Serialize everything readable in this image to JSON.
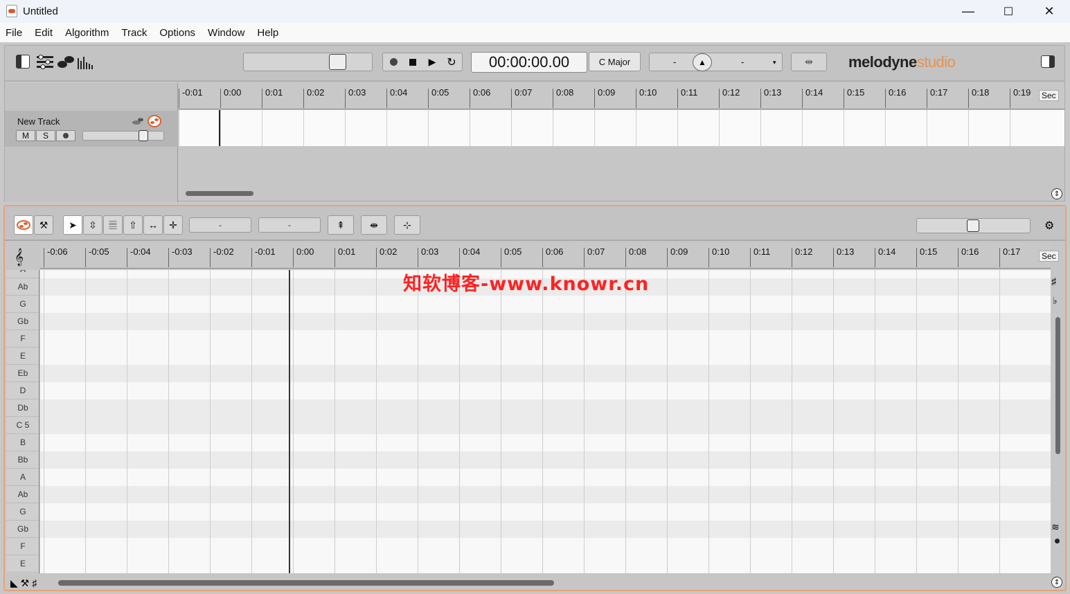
{
  "window": {
    "title": "Untitled",
    "minimize": "—",
    "maximize": "☐",
    "close": "✕"
  },
  "menu": [
    "File",
    "Edit",
    "Algorithm",
    "Track",
    "Options",
    "Window",
    "Help"
  ],
  "transport": {
    "time": "00:00:00.00",
    "key": "C Major",
    "tempo_left": "-",
    "tempo_right": "-"
  },
  "logo": {
    "main": "melodyne",
    "edition": "studio"
  },
  "arrangement": {
    "ruler_labels": [
      "-0:01",
      "0:00",
      "0:01",
      "0:02",
      "0:03",
      "0:04",
      "0:05",
      "0:06",
      "0:07",
      "0:08",
      "0:09",
      "0:10",
      "0:11",
      "0:12",
      "0:13",
      "0:14",
      "0:15",
      "0:16",
      "0:17",
      "0:18",
      "0:19"
    ],
    "ruler_unit": "Sec",
    "track": {
      "name": "New Track",
      "mute": "M",
      "solo": "S"
    }
  },
  "editor": {
    "field_1": "-",
    "field_2": "-",
    "ruler_labels": [
      "-0:06",
      "-0:05",
      "-0:04",
      "-0:03",
      "-0:02",
      "-0:01",
      "0:00",
      "0:01",
      "0:02",
      "0:03",
      "0:04",
      "0:05",
      "0:06",
      "0:07",
      "0:08",
      "0:09",
      "0:10",
      "0:11",
      "0:12",
      "0:13",
      "0:14",
      "0:15",
      "0:16",
      "0:17"
    ],
    "ruler_unit": "Sec",
    "pitch_keys": [
      "A",
      "Ab",
      "G",
      "Gb",
      "F",
      "E",
      "Eb",
      "D",
      "Db",
      "C 5",
      "B",
      "Bb",
      "A",
      "Ab",
      "G",
      "Gb",
      "F",
      "E"
    ]
  },
  "watermark": "知软博客-www.knowr.cn"
}
